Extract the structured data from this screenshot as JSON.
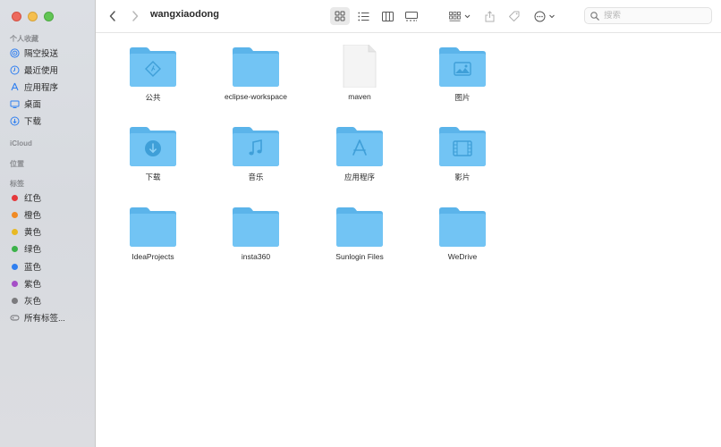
{
  "window": {
    "title": "wangxiaodong"
  },
  "toolbar": {
    "back_icon": "chevron-left-icon",
    "forward_icon": "chevron-right-icon",
    "view_icons": [
      "icon-view-icon",
      "list-view-icon",
      "column-view-icon",
      "gallery-view-icon"
    ],
    "group_icon": "group-grid-icon",
    "share_icon": "share-icon",
    "tag_icon": "tag-icon",
    "more_icon": "ellipsis-circle-icon",
    "search_placeholder": "搜索"
  },
  "sidebar": {
    "favorites_header": "个人收藏",
    "favorites": [
      {
        "label": "隔空投送",
        "icon": "airdrop-icon"
      },
      {
        "label": "最近使用",
        "icon": "clock-icon"
      },
      {
        "label": "应用程序",
        "icon": "applications-icon"
      },
      {
        "label": "桌面",
        "icon": "desktop-icon"
      },
      {
        "label": "下载",
        "icon": "download-icon"
      }
    ],
    "icloud_header": "iCloud",
    "locations_header": "位置",
    "tags_header": "标签",
    "tags": [
      {
        "label": "红色",
        "color": "#e5383b"
      },
      {
        "label": "橙色",
        "color": "#f08a24"
      },
      {
        "label": "黄色",
        "color": "#e8b923"
      },
      {
        "label": "绿色",
        "color": "#3cb24a"
      },
      {
        "label": "蓝色",
        "color": "#2f7ff0"
      },
      {
        "label": "紫色",
        "color": "#a54fc7"
      },
      {
        "label": "灰色",
        "color": "#7b7b7e"
      }
    ],
    "all_tags": "所有标签..."
  },
  "files": [
    {
      "name": "公共",
      "kind": "folder",
      "badge": "public-icon"
    },
    {
      "name": "eclipse-workspace",
      "kind": "folder",
      "badge": ""
    },
    {
      "name": "maven",
      "kind": "document",
      "badge": ""
    },
    {
      "name": "图片",
      "kind": "folder",
      "badge": "pictures-icon"
    },
    {
      "name": "下载",
      "kind": "folder",
      "badge": "download-icon"
    },
    {
      "name": "音乐",
      "kind": "folder",
      "badge": "music-icon"
    },
    {
      "name": "应用程序",
      "kind": "folder",
      "badge": "applications-icon"
    },
    {
      "name": "影片",
      "kind": "folder",
      "badge": "movies-icon"
    },
    {
      "name": "IdeaProjects",
      "kind": "folder",
      "badge": ""
    },
    {
      "name": "insta360",
      "kind": "folder",
      "badge": ""
    },
    {
      "name": "Sunlogin Files",
      "kind": "folder",
      "badge": ""
    },
    {
      "name": "WeDrive",
      "kind": "folder",
      "badge": ""
    }
  ],
  "colors": {
    "folder_body": "#6ec3f3",
    "folder_tab": "#5bb4ea",
    "folder_emblem": "#3f9fd8",
    "accent": "#2f7ff0"
  }
}
